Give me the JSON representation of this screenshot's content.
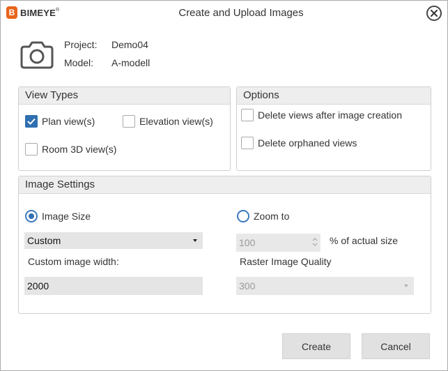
{
  "brand": {
    "badge": "B",
    "name": "BIMEYE",
    "tm": "®"
  },
  "window": {
    "title": "Create and Upload Images"
  },
  "info": {
    "project_label": "Project:",
    "project_value": "Demo04",
    "model_label": "Model:",
    "model_value": "A-modell"
  },
  "view_types": {
    "header": "View Types",
    "plan": {
      "label": "Plan view(s)",
      "checked": true
    },
    "elevation": {
      "label": "Elevation view(s)",
      "checked": false
    },
    "room3d": {
      "label": "Room 3D view(s)",
      "checked": false
    }
  },
  "options": {
    "header": "Options",
    "delete_after": {
      "label": "Delete views after image creation",
      "checked": false
    },
    "delete_orphaned": {
      "label": "Delete orphaned views",
      "checked": false
    }
  },
  "image_settings": {
    "header": "Image Settings",
    "image_size": {
      "label": "Image Size",
      "selected": true
    },
    "zoom_to": {
      "label": "Zoom to",
      "selected": false
    },
    "size_select_value": "Custom",
    "zoom_value": "100",
    "zoom_suffix": "% of actual size",
    "custom_width_label": "Custom image width:",
    "custom_width_value": "2000",
    "raster_quality_label": "Raster Image Quality",
    "raster_quality_value": "300"
  },
  "buttons": {
    "create": "Create",
    "cancel": "Cancel"
  },
  "colors": {
    "accent": "#2f6fb1",
    "brand": "#e8641b",
    "header_bg": "#eeeeee",
    "field_bg": "#e5e5e5"
  },
  "icons": {
    "camera": "camera-icon",
    "close": "close-icon",
    "check": "check-icon"
  }
}
